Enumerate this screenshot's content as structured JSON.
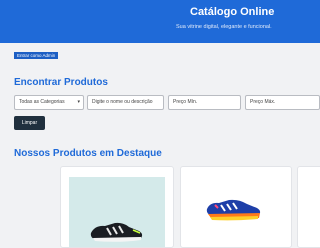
{
  "header": {
    "title": "Catálogo Online",
    "tagline": "Sua vitrine digital, elegante e funcional."
  },
  "admin_link": "Entrar como Admin",
  "filters": {
    "title": "Encontrar Produtos",
    "category": "Todas as Categorias",
    "search_placeholder": "Digite o nome ou descrição",
    "min_price_placeholder": "Preço Mín.",
    "max_price_placeholder": "Preço Máx.",
    "clear_label": "Limpar"
  },
  "products": {
    "title": "Nossos Produtos em Destaque",
    "items": [
      {
        "image": "running-shoe-black",
        "image_bg": "#d4eaea"
      },
      {
        "image": "running-shoe-blue",
        "image_bg": "#ffffff"
      }
    ]
  },
  "colors": {
    "brand": "#1f6ad8",
    "button_dark": "#20303e",
    "page_bg": "#f1f2f4"
  }
}
